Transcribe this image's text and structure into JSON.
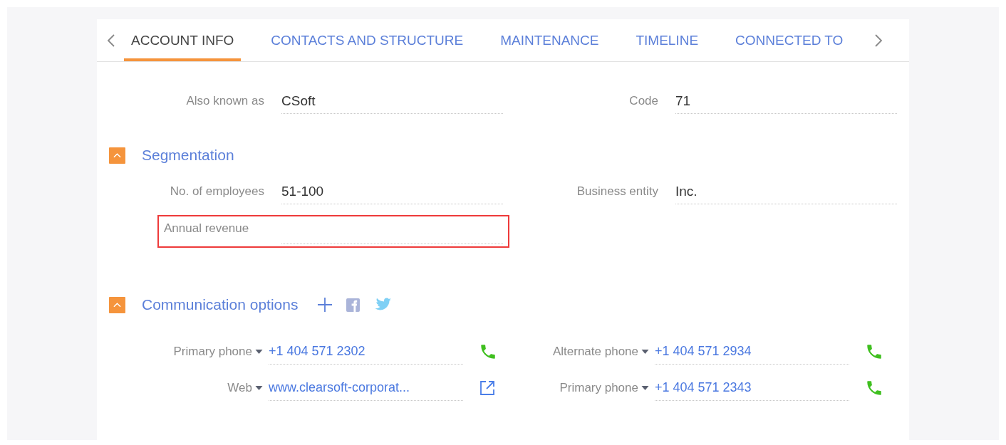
{
  "tabs": [
    {
      "label": "ACCOUNT INFO",
      "selected": true
    },
    {
      "label": "CONTACTS AND STRUCTURE",
      "selected": false
    },
    {
      "label": "MAINTENANCE",
      "selected": false
    },
    {
      "label": "TIMELINE",
      "selected": false
    },
    {
      "label": "CONNECTED TO",
      "selected": false
    }
  ],
  "top_fields": [
    {
      "label": "Also known as",
      "value": "CSoft",
      "highlighted": false
    },
    {
      "label": "Code",
      "value": "71",
      "highlighted": false
    }
  ],
  "sections": [
    {
      "title": "Segmentation",
      "expanded": true,
      "social": false,
      "fields": [
        {
          "label": "No. of employees",
          "value": "51-100",
          "highlighted": false
        },
        {
          "label": "Business entity",
          "value": "Inc.",
          "highlighted": false
        },
        {
          "label": "Annual revenue",
          "highlighted": true
        }
      ]
    },
    {
      "title": "Communication options",
      "expanded": true,
      "social": true,
      "options": [
        {
          "kind": "phone",
          "type": "Primary phone",
          "value": "+1 404 571 2302"
        },
        {
          "kind": "phone",
          "type": "Alternate phone",
          "value": "+1 404 571 2934"
        },
        {
          "kind": "web",
          "type": "Web",
          "value": "www.clearsoft-corporat..."
        },
        {
          "kind": "phone",
          "type": "Primary phone",
          "value": "+1 404 571 2343"
        }
      ]
    }
  ]
}
